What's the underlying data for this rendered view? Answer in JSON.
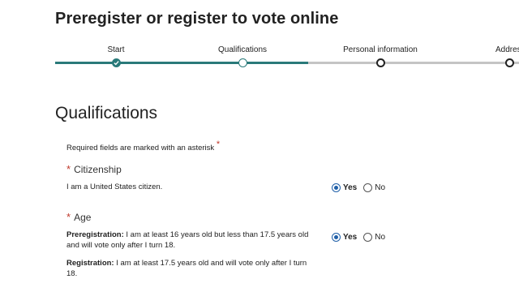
{
  "page": {
    "title": "Preregister or register to vote online"
  },
  "stepper": {
    "steps": [
      {
        "label": "Start",
        "state": "complete"
      },
      {
        "label": "Qualifications",
        "state": "current"
      },
      {
        "label": "Personal information",
        "state": "pending"
      },
      {
        "label": "Addres",
        "state": "pending"
      }
    ]
  },
  "section": {
    "title": "Qualifications",
    "required_note": "Required fields are marked with an asterisk",
    "required_marker": "*"
  },
  "citizenship": {
    "heading": "Citizenship",
    "asterisk": "*",
    "statement": "I am a United States citizen.",
    "options": {
      "yes": "Yes",
      "no": "No"
    },
    "selected": "yes"
  },
  "age": {
    "heading": "Age",
    "asterisk": "*",
    "preregistration_label": "Preregistration:",
    "preregistration_text": " I am at least 16 years old but less than 17.5 years old and will vote only after I turn 18.",
    "registration_label": "Registration:",
    "registration_text": " I am at least 17.5 years old and will vote only after I turn 18.",
    "options": {
      "yes": "Yes",
      "no": "No"
    },
    "selected": "yes"
  },
  "colors": {
    "progress_complete": "#2a7a7a",
    "progress_pending": "#c4c4c4",
    "asterisk": "#c0392b",
    "radio_selected": "#1f5fa8"
  }
}
